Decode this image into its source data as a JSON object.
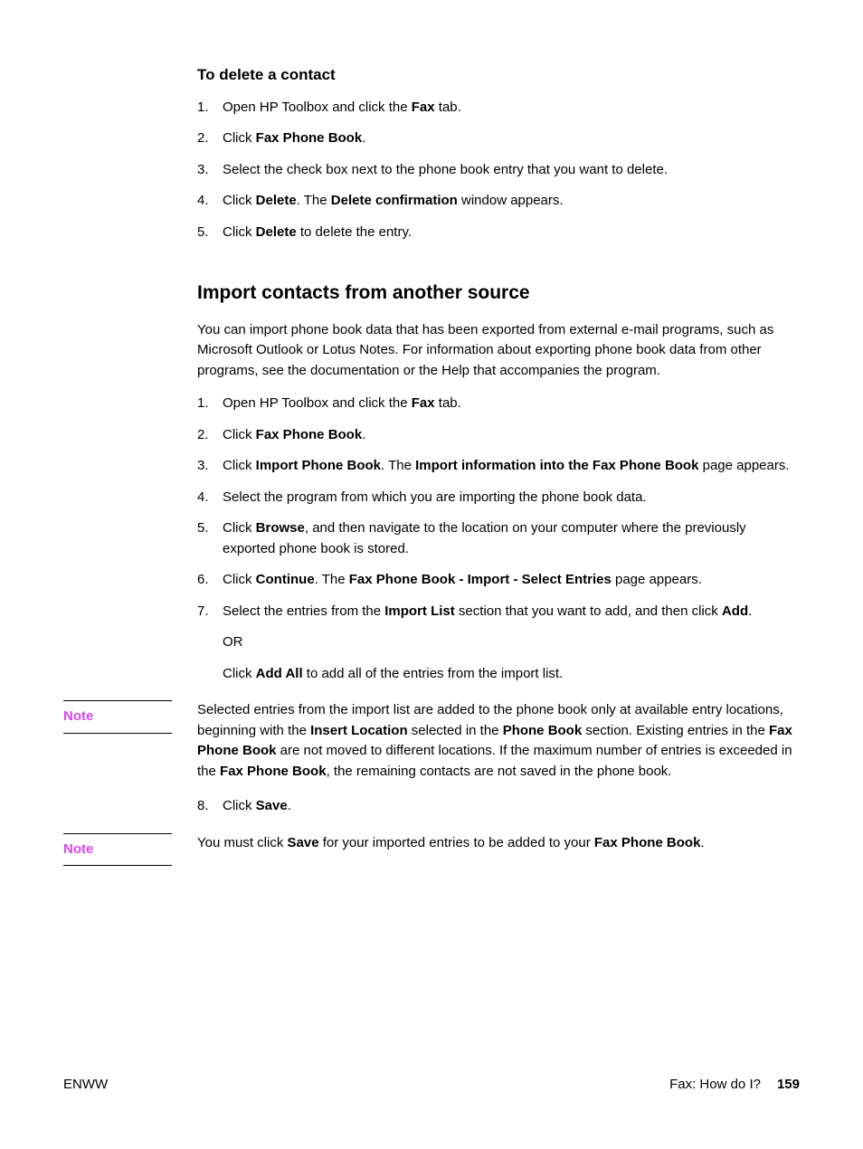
{
  "section1": {
    "heading": "To delete a contact",
    "steps": [
      {
        "prefix": "Open HP Toolbox and click the ",
        "bold1": "Fax",
        "suffix": " tab."
      },
      {
        "prefix": "Click ",
        "bold1": "Fax Phone Book",
        "suffix": "."
      },
      {
        "prefix": "Select the check box next to the phone book entry that you want to delete."
      },
      {
        "prefix": "Click ",
        "bold1": "Delete",
        "mid": ". The ",
        "bold2": "Delete confirmation",
        "suffix": " window appears."
      },
      {
        "prefix": "Click ",
        "bold1": "Delete",
        "suffix": " to delete the entry."
      }
    ]
  },
  "section2": {
    "heading": "Import contacts from another source",
    "intro": "You can import phone book data that has been exported from external e-mail programs, such as Microsoft Outlook or Lotus Notes. For information about exporting phone book data from other programs, see the documentation or the Help that accompanies the program.",
    "steps": {
      "s1": {
        "prefix": "Open HP Toolbox and click the ",
        "bold1": "Fax",
        "suffix": " tab."
      },
      "s2": {
        "prefix": "Click ",
        "bold1": "Fax Phone Book",
        "suffix": "."
      },
      "s3": {
        "prefix": "Click ",
        "bold1": "Import Phone Book",
        "mid": ". The ",
        "bold2": "Import information into the Fax Phone Book",
        "suffix": " page appears."
      },
      "s4": {
        "prefix": "Select the program from which you are importing the phone book data."
      },
      "s5": {
        "prefix": "Click ",
        "bold1": "Browse",
        "suffix": ", and then navigate to the location on your computer where the previously exported phone book is stored."
      },
      "s6": {
        "prefix": "Click ",
        "bold1": "Continue",
        "mid": ". The ",
        "bold2": "Fax Phone Book - Import - Select Entries",
        "suffix": " page appears."
      },
      "s7": {
        "prefix": "Select the entries from the ",
        "bold1": "Import List",
        "mid": " section that you want to add, and then click ",
        "bold2": "Add",
        "suffix": ".",
        "or": "OR",
        "alt_prefix": "Click ",
        "alt_bold": "Add All",
        "alt_suffix": " to add all of the entries from the import list."
      },
      "s8": {
        "prefix": "Click ",
        "bold1": "Save",
        "suffix": "."
      }
    }
  },
  "note1": {
    "label": "Note",
    "t1": "Selected entries from the import list are added to the phone book only at available entry locations, beginning with the ",
    "b1": "Insert Location",
    "t2": " selected in the ",
    "b2": "Phone Book",
    "t3": " section. Existing entries in the ",
    "b3": "Fax Phone Book",
    "t4": " are not moved to different locations. If the maximum number of entries is exceeded in the ",
    "b4": "Fax Phone Book",
    "t5": ", the remaining contacts are not saved in the phone book."
  },
  "note2": {
    "label": "Note",
    "t1": "You must click ",
    "b1": "Save",
    "t2": " for your imported entries to be added to your ",
    "b2": "Fax Phone Book",
    "t3": "."
  },
  "footer": {
    "left": "ENWW",
    "right": "Fax: How do I?",
    "page": "159"
  }
}
